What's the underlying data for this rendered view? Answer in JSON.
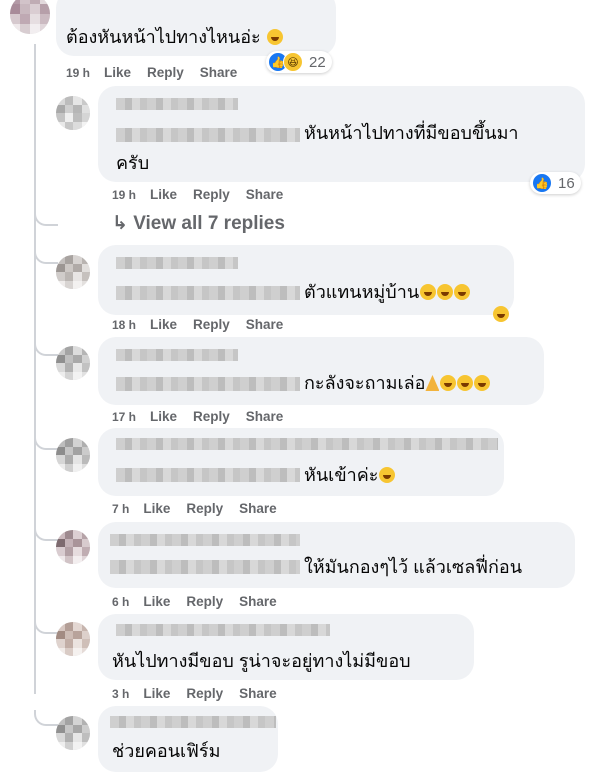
{
  "comments": [
    {
      "text": "ต้องหันหน้าไปทางไหนอ่ะ",
      "emojis": [
        "haha"
      ],
      "time": "19 h",
      "like": "Like",
      "reply": "Reply",
      "share": "Share",
      "reaction_count": "22",
      "reactions": [
        "like",
        "haha"
      ]
    },
    {
      "text_line1": "หันหน้าไปทางที่มีขอบขึ้นมา",
      "text_line2": "ครับ",
      "time": "19 h",
      "like": "Like",
      "reply": "Reply",
      "share": "Share",
      "reaction_count": "16",
      "reactions": [
        "like"
      ]
    },
    {
      "text": "ตัวแทนหมู่บ้าน",
      "emojis": [
        "haha",
        "haha",
        "haha",
        "haha"
      ],
      "time": "18 h",
      "like": "Like",
      "reply": "Reply",
      "share": "Share"
    },
    {
      "text": "กะลังจะถามเล่อ",
      "emojis": [
        "pray",
        "rofl",
        "rofl",
        "rofl"
      ],
      "time": "17 h",
      "like": "Like",
      "reply": "Reply",
      "share": "Share"
    },
    {
      "text": "หันเข้าค่ะ",
      "emojis": [
        "smile"
      ],
      "time": "7 h",
      "like": "Like",
      "reply": "Reply",
      "share": "Share"
    },
    {
      "text": "ให้มันกองๆไว้ แล้วเซลฟี่ก่อน",
      "time": "6 h",
      "like": "Like",
      "reply": "Reply",
      "share": "Share"
    },
    {
      "text": "หันไปทางมีขอบ รูน่าจะอยู่ทางไม่มีขอบ",
      "time": "3 h",
      "like": "Like",
      "reply": "Reply",
      "share": "Share"
    },
    {
      "text": "ช่วยคอนเฟิร์ม"
    }
  ],
  "view_all_replies": "View all 7 replies",
  "colors": {
    "bubble": "#f0f2f5",
    "meta": "#65676b",
    "like_blue": "#1877f2",
    "haha_yellow": "#f7c531"
  }
}
